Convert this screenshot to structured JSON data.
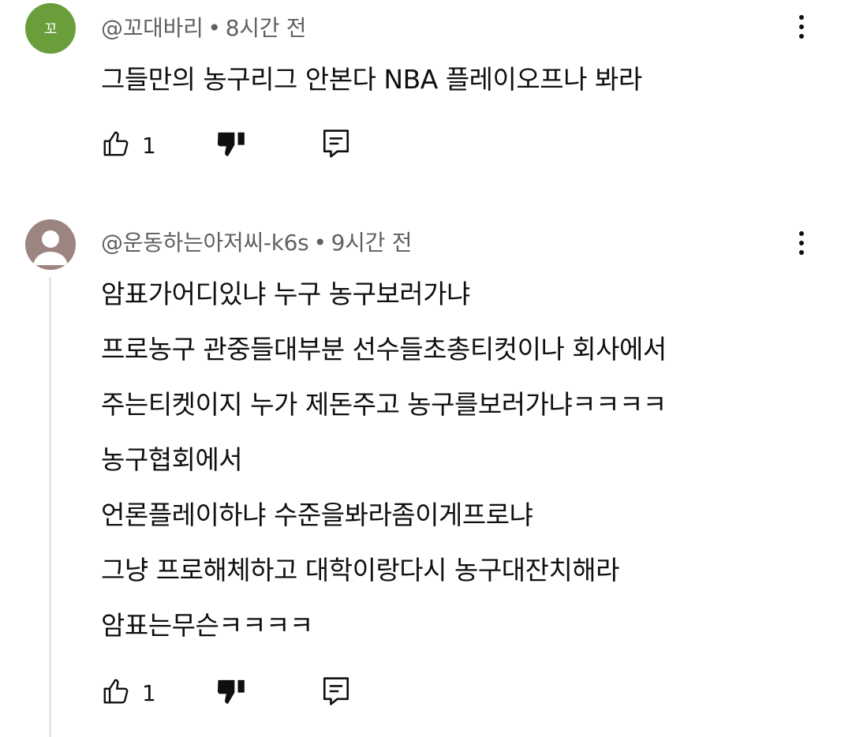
{
  "comments": [
    {
      "avatar_text": "꼬",
      "author": "@꼬대바리",
      "separator": "•",
      "time": "8시간 전",
      "lines": [
        "그들만의 농구리그 안본다 NBA 플레이오프나 봐라"
      ],
      "like_count": "1"
    },
    {
      "author": "@운동하는아저씨-k6s",
      "separator": "•",
      "time": "9시간 전",
      "lines": [
        "암표가어디있냐 누구 농구보러가냐",
        "프로농구 관중들대부분 선수들초총티컷이나 회사에서",
        "주는티켓이지 누가 제돈주고 농구를보러가냐ㅋㅋㅋㅋ",
        "농구협회에서",
        "언론플레이하냐 수준을봐라좀이게프로냐",
        "그냥 프로해체하고 대학이랑다시 농구대잔치해라",
        "암표는무슨ㅋㅋㅋㅋ"
      ],
      "like_count": "1"
    }
  ],
  "icons": {
    "like": "thumbs-up-outline-icon",
    "dislike": "thumbs-down-filled-icon",
    "reply": "reply-icon",
    "menu": "more-vert-icon"
  },
  "colors": {
    "avatar_green": "#6a9e3b",
    "avatar_default": "#9c8580",
    "meta_gray": "#606060"
  }
}
